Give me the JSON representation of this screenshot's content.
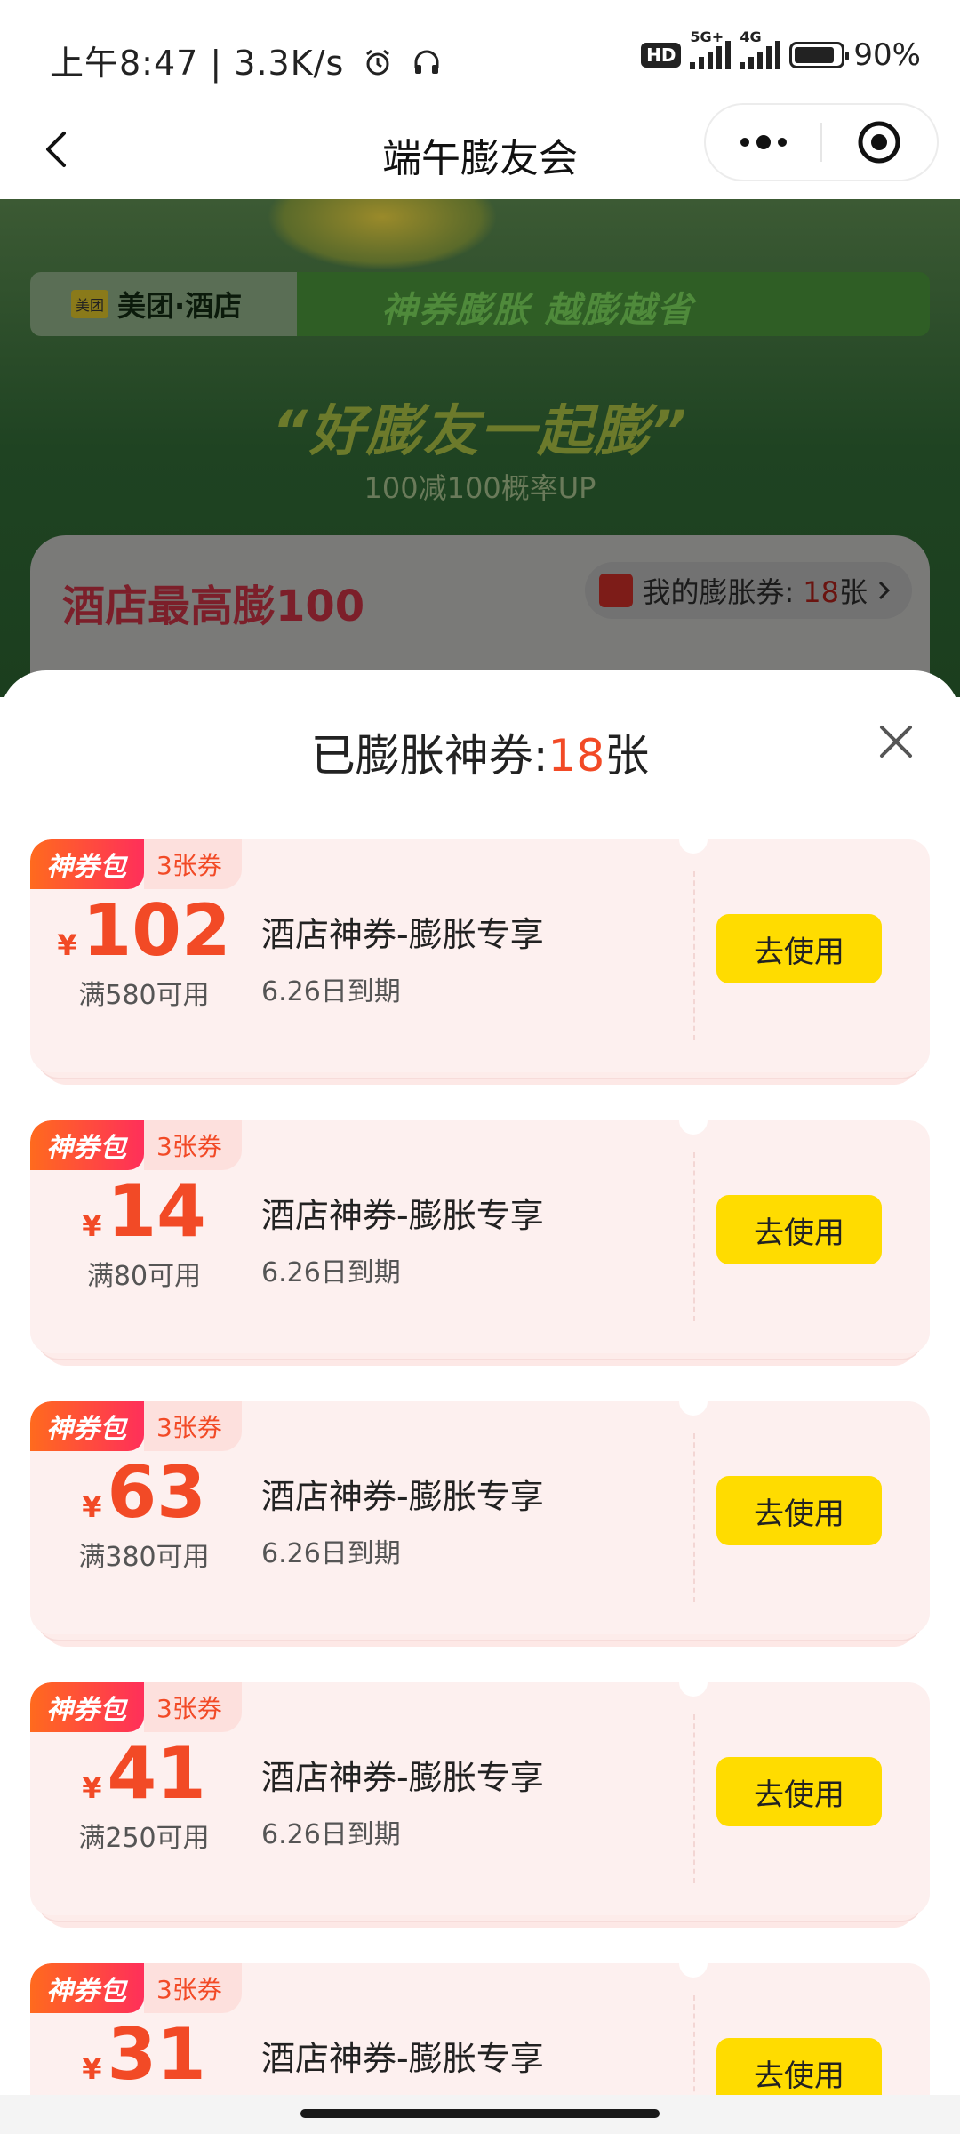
{
  "status_bar": {
    "time": "上午8:47 | 3.3K/s",
    "hd_label": "HD",
    "network_1": "5G+",
    "network_2": "4G",
    "battery": "90%"
  },
  "nav": {
    "title": "端午膨友会"
  },
  "banner": {
    "brand_logo_text": "美团",
    "brand_name": "美团·酒店",
    "slogan": "神券膨胀 越膨越省",
    "headline": "“好膨友一起膨”",
    "subline": "100减100概率UP",
    "card_title": "酒店最高膨100",
    "my_coupons_label": "我的膨胀券:",
    "my_coupons_count": "18",
    "my_coupons_unit": "张"
  },
  "sheet": {
    "title_prefix": "已膨胀神券:",
    "title_count": "18",
    "title_unit": "张"
  },
  "coupons": [
    {
      "tag": "神券包",
      "count": "3张券",
      "currency": "¥",
      "amount": "102",
      "condition": "满580可用",
      "title": "酒店神券-膨胀专享",
      "expire": "6.26日到期",
      "button": "去使用"
    },
    {
      "tag": "神券包",
      "count": "3张券",
      "currency": "¥",
      "amount": "14",
      "condition": "满80可用",
      "title": "酒店神券-膨胀专享",
      "expire": "6.26日到期",
      "button": "去使用"
    },
    {
      "tag": "神券包",
      "count": "3张券",
      "currency": "¥",
      "amount": "63",
      "condition": "满380可用",
      "title": "酒店神券-膨胀专享",
      "expire": "6.26日到期",
      "button": "去使用"
    },
    {
      "tag": "神券包",
      "count": "3张券",
      "currency": "¥",
      "amount": "41",
      "condition": "满250可用",
      "title": "酒店神券-膨胀专享",
      "expire": "6.26日到期",
      "button": "去使用"
    },
    {
      "tag": "神券包",
      "count": "3张券",
      "currency": "¥",
      "amount": "31",
      "condition": "",
      "title": "酒店神券-膨胀专享",
      "expire": "",
      "button": "去使用"
    }
  ],
  "colors": {
    "accent_red": "#f24a26",
    "button_yellow": "#ffdc00",
    "coupon_bg": "#fdf0ef"
  },
  "icons": [
    "back-arrow-icon",
    "more-dots-icon",
    "target-icon",
    "close-icon",
    "alarm-icon",
    "headset-icon",
    "signal-icon",
    "battery-icon",
    "coupon-icon",
    "chevron-right-icon"
  ]
}
